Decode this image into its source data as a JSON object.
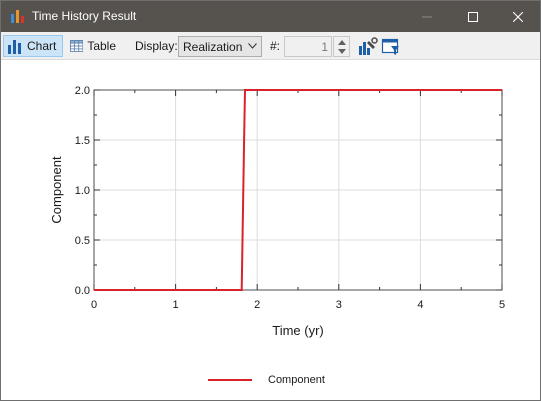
{
  "window": {
    "title": "Time History Result"
  },
  "toolbar": {
    "chart_label": "Chart",
    "table_label": "Table",
    "display_label": "Display:",
    "display_value": "Realization",
    "number_label": "#:",
    "number_value": "1"
  },
  "colors": {
    "titlebar": "#56524e",
    "series": "#d9222a",
    "active_tab": "#cce4f7"
  },
  "chart_data": {
    "type": "line",
    "xlabel": "Time (yr)",
    "ylabel": "Component",
    "xlim": [
      0,
      5
    ],
    "ylim": [
      0,
      2
    ],
    "x_ticks": [
      "0",
      "1",
      "2",
      "3",
      "4",
      "5"
    ],
    "y_ticks": [
      "0.0",
      "0.5",
      "1.0",
      "1.5",
      "2.0"
    ],
    "grid": true,
    "legend_position": "bottom",
    "series": [
      {
        "name": "Component",
        "points": [
          [
            0,
            0
          ],
          [
            1.81,
            0
          ],
          [
            1.82,
            0.5
          ],
          [
            1.83,
            1.0
          ],
          [
            1.84,
            1.5
          ],
          [
            1.85,
            2.0
          ],
          [
            5,
            2.0
          ]
        ]
      }
    ]
  }
}
